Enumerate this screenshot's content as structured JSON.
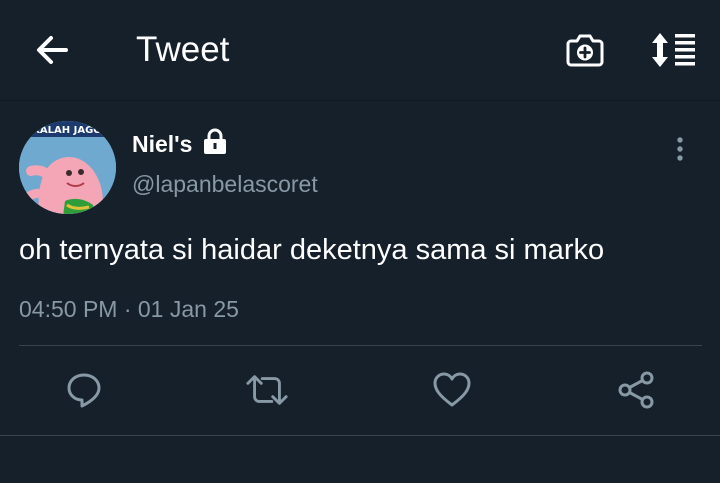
{
  "header": {
    "back_icon": "arrow-left-icon",
    "title": "Tweet",
    "camera_icon": "camera-plus-icon",
    "sort_icon": "sort-lines-icon"
  },
  "tweet": {
    "display_name": "Niel's",
    "protected_icon": "lock-icon",
    "handle": "@lapanbelascoret",
    "text": "oh ternyata si haidar deketnya sama si marko",
    "timestamp": "04:50 PM · 01 Jan 25",
    "avatar_caption": "KALAH JAGO",
    "more_icon": "more-vertical-icon"
  },
  "actions": [
    {
      "name": "reply",
      "icon": "reply-bubble-icon"
    },
    {
      "name": "retweet",
      "icon": "retweet-icon"
    },
    {
      "name": "like",
      "icon": "heart-icon"
    },
    {
      "name": "share",
      "icon": "share-icon"
    }
  ],
  "colors": {
    "background": "#15202b",
    "text_primary": "#ffffff",
    "text_secondary": "#8899a6",
    "divider": "#38444d"
  }
}
